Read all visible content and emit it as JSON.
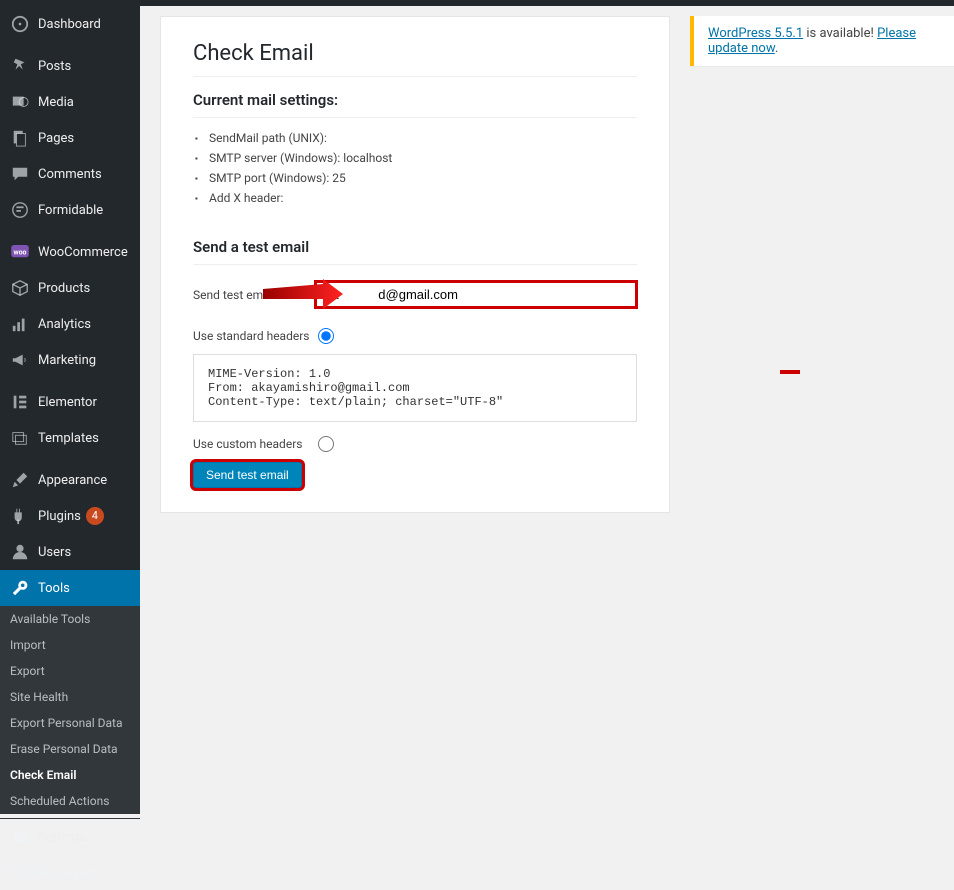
{
  "sidebar": {
    "items": [
      {
        "label": "Dashboard"
      },
      {
        "label": "Posts"
      },
      {
        "label": "Media"
      },
      {
        "label": "Pages"
      },
      {
        "label": "Comments"
      },
      {
        "label": "Formidable"
      },
      {
        "label": "WooCommerce"
      },
      {
        "label": "Products"
      },
      {
        "label": "Analytics"
      },
      {
        "label": "Marketing"
      },
      {
        "label": "Elementor"
      },
      {
        "label": "Templates"
      },
      {
        "label": "Appearance"
      },
      {
        "label": "Plugins"
      },
      {
        "label": "Users"
      },
      {
        "label": "Tools"
      },
      {
        "label": "Settings"
      }
    ],
    "plugins_badge": "4",
    "submenu": [
      "Available Tools",
      "Import",
      "Export",
      "Site Health",
      "Export Personal Data",
      "Erase Personal Data",
      "Check Email",
      "Scheduled Actions"
    ],
    "collapse_label": "Collapse menu"
  },
  "notice": {
    "prefix_link": "WordPress 5.5.1",
    "mid_text": " is available! ",
    "action_link": "Please update now",
    "period": "."
  },
  "page": {
    "title": "Check Email",
    "settings_heading": "Current mail settings:",
    "settings": {
      "sendmail_label": "SendMail path (UNIX):",
      "smtp_server_label": "SMTP server (Windows): ",
      "smtp_server_value": "localhost",
      "smtp_port_label": "SMTP port (Windows): ",
      "smtp_port_value": "25",
      "xheader_label": "Add X header:"
    },
    "send_heading": "Send a test email",
    "email_label": "Send test email to:",
    "email_value": "ca           d@gmail.com",
    "standard_label": "Use standard headers",
    "custom_label": "Use custom headers",
    "headers_text": "MIME-Version: 1.0\nFrom: akayamishiro@gmail.com\nContent-Type: text/plain; charset=\"UTF-8\"",
    "button_label": "Send test email"
  }
}
